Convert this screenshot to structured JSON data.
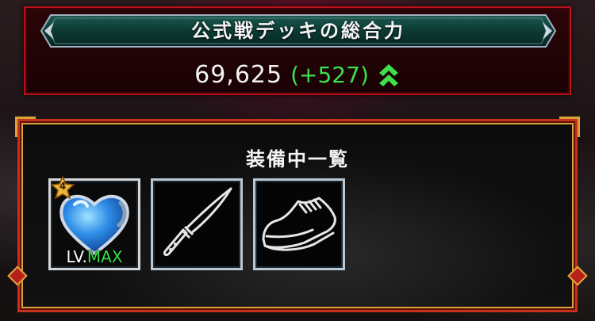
{
  "power_panel": {
    "title": "公式戦デッキの総合力",
    "value": "69,625",
    "diff": "(+527)",
    "up_icon": "double-chevron-up-icon",
    "colors": {
      "diff": "#3ee04a",
      "frame": "#b8101c",
      "banner": "#0f3b34"
    }
  },
  "equipment": {
    "title": "装備中一覧",
    "slots": [
      {
        "item_icon": "blue-heart-icon",
        "rank": "4",
        "level_prefix": "LV.",
        "level_value": "MAX"
      },
      {
        "item_icon": "knife-icon"
      },
      {
        "item_icon": "sneaker-icon"
      }
    ],
    "colors": {
      "frame": "#c7301a",
      "trim": "#d8a23a",
      "max": "#36e04a"
    }
  }
}
